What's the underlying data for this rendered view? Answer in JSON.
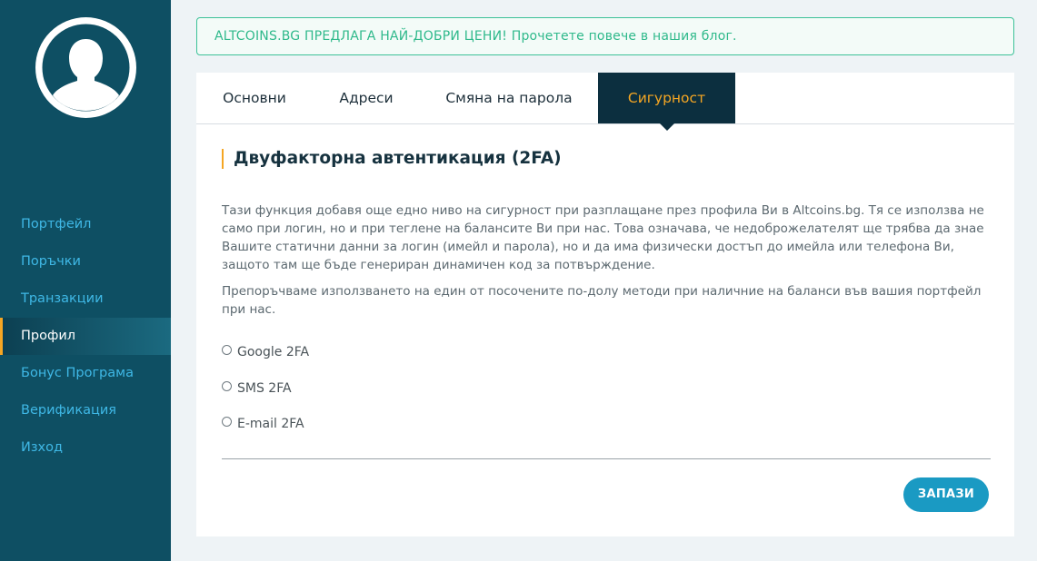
{
  "sidebar": {
    "avatar_icon": "user-silhouette-icon",
    "items": [
      {
        "label": "Портфейл"
      },
      {
        "label": "Поръчки"
      },
      {
        "label": "Транзакции"
      },
      {
        "label": "Профил",
        "active": true
      },
      {
        "label": "Бонус Програма"
      },
      {
        "label": "Верификация"
      },
      {
        "label": "Изход"
      }
    ]
  },
  "banner": {
    "text": "ALTCOINS.BG ПРЕДЛАГА НАЙ-ДОБРИ ЦЕНИ! Прочетете повече в нашия блог."
  },
  "tabs": [
    {
      "label": "Основни"
    },
    {
      "label": "Адреси"
    },
    {
      "label": "Смяна на парола"
    },
    {
      "label": "Сигурност",
      "active": true
    }
  ],
  "security": {
    "title": "Двуфакторна автентикация (2FA)",
    "paragraph1": "Тази функция добавя още едно ниво на сигурност при разплащане през профила Ви в Altcoins.bg. Тя се използва не само при логин, но и при теглене на балансите Ви при нас. Това означава, че недоброжелателят ще трябва да знае Вашите статични данни за логин (имейл и парола), но и да има физически достъп до имейла или телефона Ви, защото там ще бъде генериран динамичен код за потвърждение.",
    "paragraph2": "Препоръчваме използването на един от посочените по-долу методи при наличние на баланси във вашия портфейл при нас.",
    "options": [
      {
        "label": "Google 2FA",
        "checked": false
      },
      {
        "label": "SMS 2FA",
        "checked": false
      },
      {
        "label": "E-mail 2FA",
        "checked": false
      }
    ],
    "save_label": "ЗАПАЗИ"
  },
  "colors": {
    "sidebar_bg": "#0e4f63",
    "nav_link": "#3fb8e6",
    "accent": "#f5a623",
    "banner_green": "#2fb98b",
    "active_tab_bg": "#0c2f3f",
    "button_blue": "#1a9ac3"
  }
}
